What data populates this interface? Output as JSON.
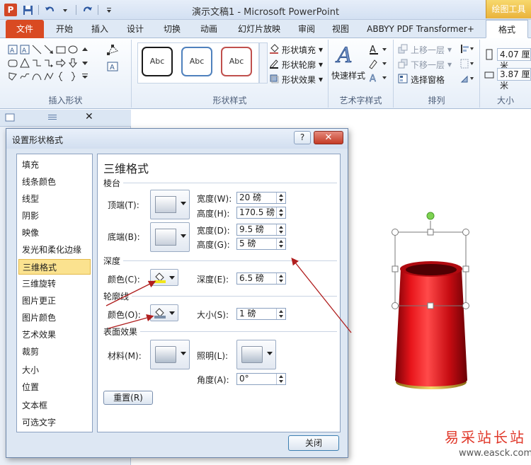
{
  "window": {
    "title": "演示文稿1 - Microsoft PowerPoint",
    "app_icon_letter": "P",
    "contextual_tab_group": "绘图工具"
  },
  "ribbon": {
    "tabs": [
      {
        "label": "文件",
        "active": false,
        "file": true
      },
      {
        "label": "开始",
        "active": false
      },
      {
        "label": "插入",
        "active": false
      },
      {
        "label": "设计",
        "active": false
      },
      {
        "label": "切换",
        "active": false
      },
      {
        "label": "动画",
        "active": false
      },
      {
        "label": "幻灯片放映",
        "active": false
      },
      {
        "label": "审阅",
        "active": false
      },
      {
        "label": "视图",
        "active": false
      },
      {
        "label": "ABBYY PDF Transformer+",
        "active": false
      },
      {
        "label": "格式",
        "active": true
      }
    ],
    "groups": {
      "insert_shapes": "插入形状",
      "shape_styles": "形状样式",
      "wordart_styles": "艺术字样式",
      "arrange": "排列",
      "size": "大小"
    },
    "style_preview_text": "Abc",
    "style_preview_colors": [
      "#1a1a1a",
      "#4f81bd",
      "#c0504d"
    ],
    "shape_fill": "形状填充",
    "shape_outline": "形状轮廓",
    "shape_effects": "形状效果",
    "quick_styles": "快速样式",
    "bring_forward": "上移一层",
    "send_backward": "下移一层",
    "selection_pane": "选择窗格",
    "height_value": "4.07 厘米",
    "width_value": "3.87 厘米"
  },
  "dialog": {
    "title": "设置形状格式",
    "help": "?",
    "close_x": "✕",
    "categories": [
      {
        "label": "填充",
        "selected": false
      },
      {
        "label": "线条颜色",
        "selected": false
      },
      {
        "label": "线型",
        "selected": false
      },
      {
        "label": "阴影",
        "selected": false
      },
      {
        "label": "映像",
        "selected": false
      },
      {
        "label": "发光和柔化边缘",
        "selected": false
      },
      {
        "label": "三维格式",
        "selected": true
      },
      {
        "label": "三维旋转",
        "selected": false
      },
      {
        "label": "图片更正",
        "selected": false
      },
      {
        "label": "图片颜色",
        "selected": false
      },
      {
        "label": "艺术效果",
        "selected": false
      },
      {
        "label": "裁剪",
        "selected": false
      },
      {
        "label": "大小",
        "selected": false
      },
      {
        "label": "位置",
        "selected": false
      },
      {
        "label": "文本框",
        "selected": false
      },
      {
        "label": "可选文字",
        "selected": false
      }
    ],
    "panel": {
      "title": "三维格式",
      "bevel": {
        "section": "棱台",
        "top_label": "顶端(T):",
        "bottom_label": "底端(B):",
        "top_width_label": "宽度(W):",
        "top_width": "20 磅",
        "top_height_label": "高度(H):",
        "top_height": "170.5 磅",
        "bottom_width_label": "宽度(D):",
        "bottom_width": "9.5 磅",
        "bottom_height_label": "高度(G):",
        "bottom_height": "5 磅"
      },
      "depth": {
        "section": "深度",
        "color_label": "颜色(C):",
        "depth_label": "深度(E):",
        "depth_value": "6.5 磅",
        "color": "#f2e51a"
      },
      "contour": {
        "section": "轮廓线",
        "color_label": "颜色(O):",
        "size_label": "大小(S):",
        "size_value": "1 磅",
        "color": "#7a8ea8"
      },
      "surface": {
        "section": "表面效果",
        "material_label": "材料(M):",
        "lighting_label": "照明(L):",
        "angle_label": "角度(A):",
        "angle_value": "0°"
      },
      "reset_button": "重置(R)"
    },
    "close_button": "关闭"
  },
  "slide": {
    "shape_colors": {
      "body": "#d0121a",
      "rim": "#e9c34a"
    }
  },
  "watermark": {
    "text": "易采站长站",
    "url": "www.easck.com"
  }
}
